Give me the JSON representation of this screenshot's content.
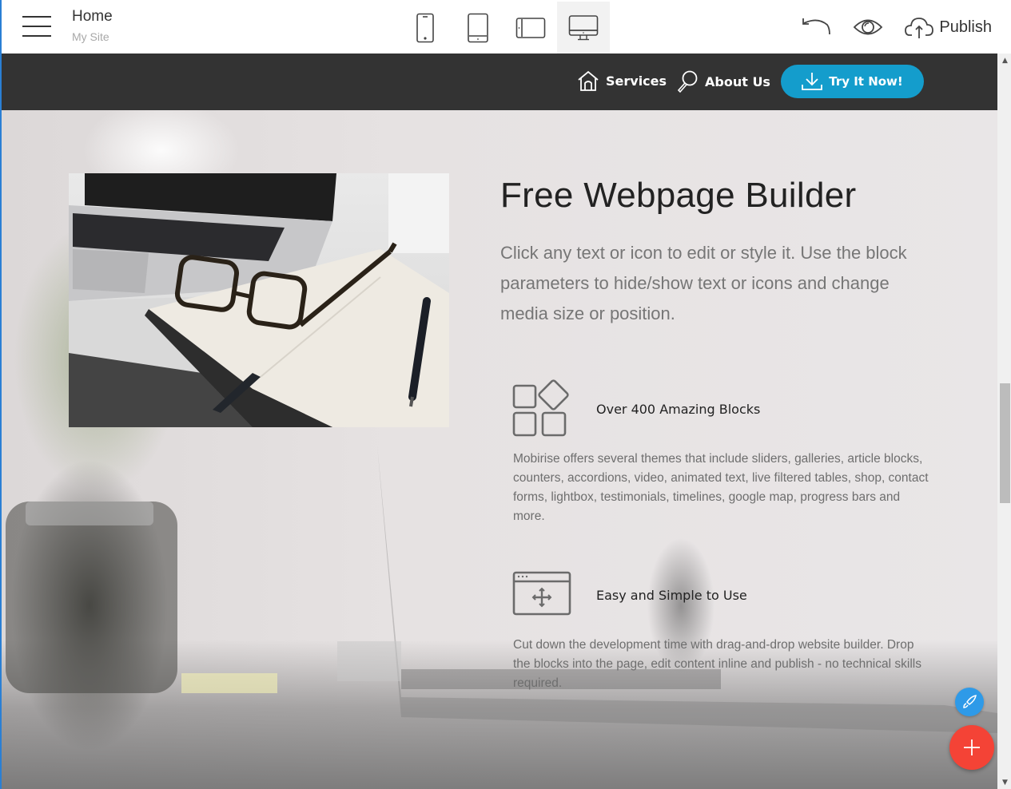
{
  "editor": {
    "page_title": "Home",
    "site_name": "My Site",
    "menu_icon": "hamburger-icon",
    "devices": [
      {
        "name": "mobile",
        "icon": "phone-icon",
        "active": false
      },
      {
        "name": "tablet",
        "icon": "tablet-icon",
        "active": false
      },
      {
        "name": "tablet-landscape",
        "icon": "tablet-landscape-icon",
        "active": false
      },
      {
        "name": "desktop",
        "icon": "desktop-icon",
        "active": true
      }
    ],
    "undo_icon": "undo-icon",
    "preview_icon": "eye-icon",
    "publish_label": "Publish",
    "publish_icon": "cloud-upload-icon"
  },
  "site_nav": {
    "links": [
      {
        "label": "Services",
        "icon": "home-icon"
      },
      {
        "label": "About Us",
        "icon": "search-icon"
      }
    ],
    "cta": {
      "label": "Try It Now!",
      "icon": "download-icon",
      "color": "#149dcc"
    }
  },
  "hero": {
    "heading": "Free Webpage Builder",
    "lead": "Click any text or icon to edit or style it. Use the block parameters to hide/show text or icons and change media size or position.",
    "image": "laptop-glasses-notebook-photo",
    "features": [
      {
        "icon": "blocks-icon",
        "title": "Over 400 Amazing Blocks",
        "text": "Mobirise offers several themes that include sliders, galleries, article blocks, counters, accordions, video, animated text, live filtered tables, shop, contact forms, lightbox, testimonials, timelines, google map, progress bars and more."
      },
      {
        "icon": "drag-drop-window-icon",
        "title": "Easy and Simple to Use",
        "text": "Cut down the development time with drag-and-drop website builder. Drop the blocks into the page, edit content inline and publish - no technical skills required."
      }
    ]
  },
  "floating": {
    "style_button_icon": "brush-icon",
    "style_button_color": "#2e9ae8",
    "add_button_icon": "plus-icon",
    "add_button_color": "#f44336"
  }
}
